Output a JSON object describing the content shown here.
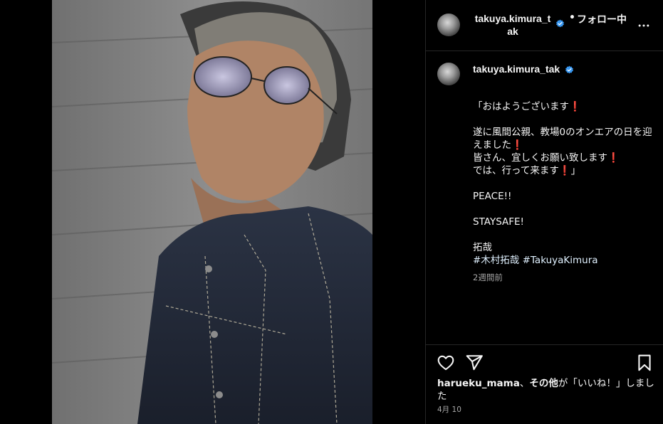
{
  "post": {
    "author": "takuya.kimura_tak",
    "author_line1": "takuya.kimura_t",
    "author_line2": "ak",
    "separator": "•",
    "follow_status": "フォロー中",
    "more_icon": "more-horizontal-icon",
    "verified_icon": "verified-badge-icon",
    "verified_color": "#3897f0"
  },
  "caption": {
    "author": "takuya.kimura_tak",
    "text": "「おはようございます❗\n\n遂に風間公親、教場0のオンエアの日を迎えました❗\n皆さん、宜しくお願い致します❗\nでは、行って来ます❗」\n\nPEACE!!\n\nSTAYSAFE!\n\n拓哉",
    "hashtags": [
      "#木村拓哉",
      "#TakuyaKimura"
    ],
    "timestamp": "2週間前"
  },
  "actions": {
    "like_icon": "heart-icon",
    "share_icon": "paper-plane-icon",
    "save_icon": "bookmark-icon"
  },
  "likes": {
    "user": "harueku_mama",
    "sep": "、",
    "others": "その他",
    "suffix": "が「いいね！」しました"
  },
  "date": "4月 10"
}
